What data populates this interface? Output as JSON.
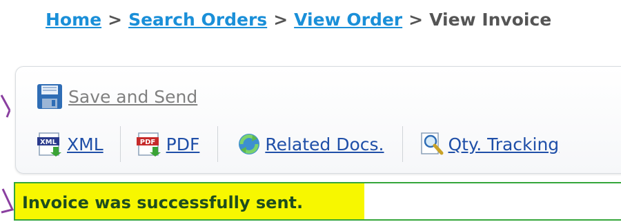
{
  "breadcrumb": {
    "items": [
      {
        "label": "Home",
        "link": true
      },
      {
        "label": "Search Orders",
        "link": true
      },
      {
        "label": "View Order",
        "link": true
      },
      {
        "label": "View Invoice",
        "link": false
      }
    ],
    "separator": ">"
  },
  "toolbar": {
    "save": {
      "label": "Save and Send",
      "icon": "floppy-disk-icon"
    },
    "actions": [
      {
        "label": "XML",
        "icon": "xml-download-icon"
      },
      {
        "label": "PDF",
        "icon": "pdf-download-icon"
      },
      {
        "label": "Related Docs.",
        "icon": "refresh-globe-icon"
      },
      {
        "label": "Qty. Tracking",
        "icon": "magnifier-document-icon"
      }
    ]
  },
  "message": {
    "text": "Invoice was successfully sent.",
    "highlight_color": "#f7f700",
    "border_color": "#34a63a"
  },
  "colors": {
    "link": "#1a8fd8",
    "action_link": "#1f4fa8",
    "annotation": "#8a3fa0"
  }
}
